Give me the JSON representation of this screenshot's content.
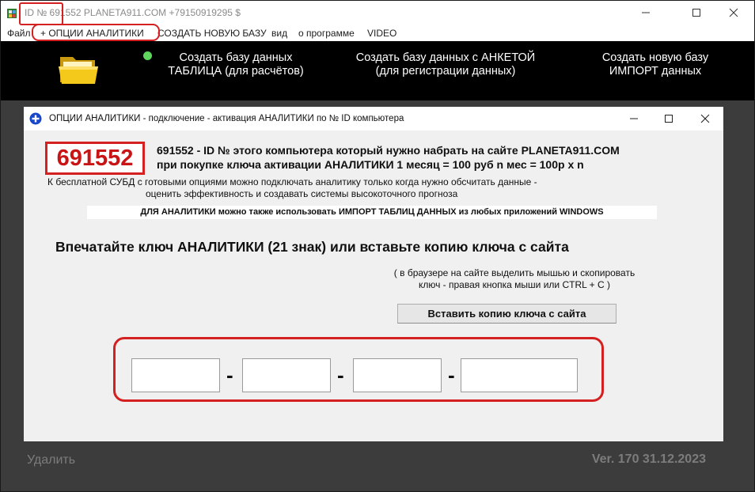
{
  "window": {
    "title": "ID № 691552 PLANETA911.COM +79150919295 $",
    "icon": "app-icon"
  },
  "menu": {
    "items": [
      {
        "label": "Файл"
      },
      {
        "label": "+ ОПЦИИ АНАЛИТИКИ"
      },
      {
        "label": "СОЗДАТЬ НОВУЮ БАЗУ"
      },
      {
        "label": "вид"
      },
      {
        "label": "о программе"
      },
      {
        "label": "VIDEO"
      }
    ]
  },
  "toolbar": {
    "buttons": [
      {
        "line1": "Создать базу данных",
        "line2": "ТАБЛИЦА (для расчётов)"
      },
      {
        "line1": "Создать базу данных с АНКЕТОЙ",
        "line2": "(для регистрации данных)"
      },
      {
        "line1": "Создать новую базу",
        "line2": "ИМПОРТ данных"
      }
    ],
    "status_dot_color": "#5ed65e"
  },
  "footer": {
    "delete_label": "Удалить",
    "version": "Ver. 170   31.12.2023"
  },
  "dialog": {
    "title": "ОПЦИИ АНАЛИТИКИ  -  подключение - активация АНАЛИТИКИ по № ID компьютера",
    "id_number": "691552",
    "id_text_line1": "691552 - ID №  этого компьютера который нужно набрать на сайте PLANETA911.COM",
    "id_text_line2": "при покупке ключа активации АНАЛИТИКИ     1 месяц = 100 руб   n мес = 100р х n",
    "free_text_line1": "К бесплатной СУБД с готовыми опциями можно подключать аналитику только когда нужно обсчитать данные -",
    "free_text_line2": "оценить эффективность и создавать системы высокоточного прогноза",
    "import_note": "ДЛЯ АНАЛИТИКИ можно также использовать ИМПОРТ ТАБЛИЦ ДАННЫХ из любых приложений WINDOWS",
    "enter_key_label": "Впечатайте ключ АНАЛИТИКИ  (21 знак)  или вставьте копию ключа с сайта",
    "browser_hint_line1": "( в браузере на сайте выделить мышью и скопировать",
    "browser_hint_line2": "ключ - правая кнопка мыши или CTRL + C )",
    "paste_button": "Вставить копию ключа с сайта",
    "key_separator": "-",
    "key_fields": [
      {
        "value": ""
      },
      {
        "value": ""
      },
      {
        "value": ""
      },
      {
        "value": ""
      }
    ]
  },
  "colors": {
    "highlight": "#d42020",
    "id_text": "#c81414",
    "toolbar_bg": "#000000",
    "background": "#3c3c3c"
  }
}
